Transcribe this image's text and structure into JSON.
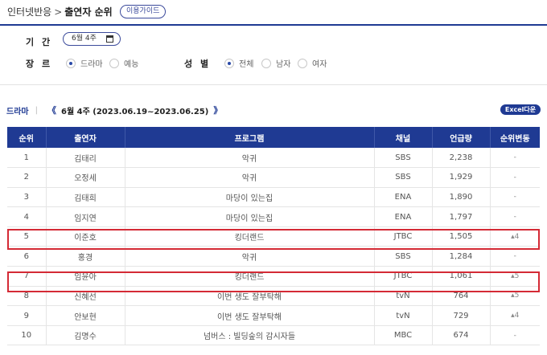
{
  "breadcrumb": {
    "parent": "인터넷반응",
    "separator": ">",
    "current": "출연자 순위"
  },
  "guide_button": "이용가이드",
  "filters": {
    "period_label": "기 간",
    "period_value": "6월 4주",
    "genre_label": "장 르",
    "genre_options": [
      {
        "label": "드라마",
        "selected": true
      },
      {
        "label": "예능",
        "selected": false
      }
    ],
    "gender_label": "성 별",
    "gender_options": [
      {
        "label": "전체",
        "selected": true
      },
      {
        "label": "남자",
        "selected": false
      },
      {
        "label": "여자",
        "selected": false
      }
    ]
  },
  "section": {
    "category": "드라마",
    "divider": "|",
    "prev": "《",
    "week": "6월 4주 (2023.06.19~2023.06.25)",
    "next": "》",
    "excel_button": "Excel다운"
  },
  "table": {
    "headers": [
      "순위",
      "출연자",
      "프로그램",
      "채널",
      "언급량",
      "순위변동"
    ],
    "rows": [
      {
        "rank": "1",
        "name": "김태리",
        "program": "악귀",
        "channel": "SBS",
        "mentions": "2,238",
        "change": "-"
      },
      {
        "rank": "2",
        "name": "오정세",
        "program": "악귀",
        "channel": "SBS",
        "mentions": "1,929",
        "change": "-"
      },
      {
        "rank": "3",
        "name": "김태희",
        "program": "마당이 있는집",
        "channel": "ENA",
        "mentions": "1,890",
        "change": "-"
      },
      {
        "rank": "4",
        "name": "임지연",
        "program": "마당이 있는집",
        "channel": "ENA",
        "mentions": "1,797",
        "change": "-"
      },
      {
        "rank": "5",
        "name": "이준호",
        "program": "킹더랜드",
        "channel": "JTBC",
        "mentions": "1,505",
        "change": "▴4"
      },
      {
        "rank": "6",
        "name": "홍경",
        "program": "악귀",
        "channel": "SBS",
        "mentions": "1,284",
        "change": "-"
      },
      {
        "rank": "7",
        "name": "임윤아",
        "program": "킹더랜드",
        "channel": "JTBC",
        "mentions": "1,061",
        "change": "▴5"
      },
      {
        "rank": "8",
        "name": "신혜선",
        "program": "이번 생도 잘부탁해",
        "channel": "tvN",
        "mentions": "764",
        "change": "▴5"
      },
      {
        "rank": "9",
        "name": "안보현",
        "program": "이번 생도 잘부탁해",
        "channel": "tvN",
        "mentions": "729",
        "change": "▴4"
      },
      {
        "rank": "10",
        "name": "김명수",
        "program": "넘버스 : 빌딩숲의 감시자들",
        "channel": "MBC",
        "mentions": "674",
        "change": "-"
      }
    ]
  },
  "colors": {
    "accent": "#1f3a93",
    "highlight_border": "#d42a35"
  }
}
